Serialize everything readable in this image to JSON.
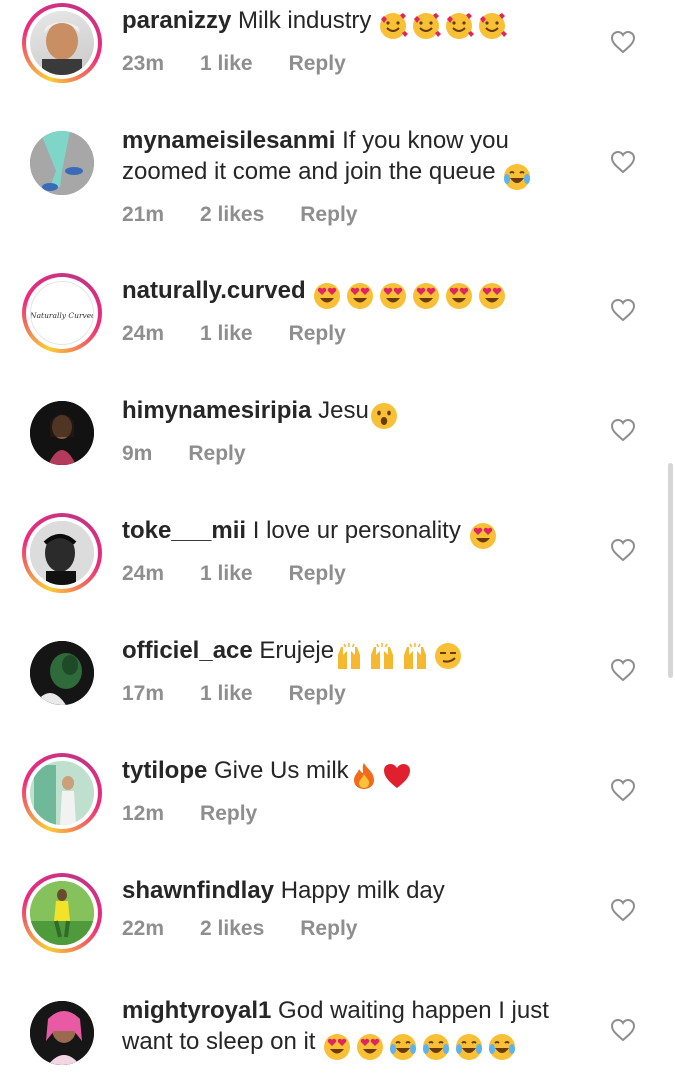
{
  "comments": [
    {
      "username": "paranizzy",
      "text": " Milk industry",
      "text2": "",
      "emoji": "smiling-hearts x4",
      "time": "23m",
      "likes": "1 like",
      "reply": "Reply"
    },
    {
      "username": "mynameisilesanmi",
      "text": " If you know you",
      "text2": "zoomed it come and join the queue",
      "emoji": "tears-of-joy",
      "time": "21m",
      "likes": "2 likes",
      "reply": "Reply"
    },
    {
      "username": "naturally.curved",
      "text": "",
      "text2": "",
      "emoji": "heart-eyes x6",
      "time": "24m",
      "likes": "1 like",
      "reply": "Reply",
      "avatar_text": "Naturally Curved"
    },
    {
      "username": "himynamesiripia",
      "text": " Jesu",
      "text2": "",
      "emoji": "surprised",
      "time": "9m",
      "likes": "",
      "reply": "Reply"
    },
    {
      "username": "toke___mii",
      "text": " I love ur personality",
      "text2": "",
      "emoji": "heart-eyes",
      "time": "24m",
      "likes": "1 like",
      "reply": "Reply"
    },
    {
      "username": "officiel_ace",
      "text": " Erujeje",
      "text2": "",
      "emoji": "raised-hands x3, smirk",
      "time": "17m",
      "likes": "1 like",
      "reply": "Reply"
    },
    {
      "username": "tytilope",
      "text": " Give Us milk",
      "text2": "",
      "emoji": "fire, red-heart",
      "time": "12m",
      "likes": "",
      "reply": "Reply"
    },
    {
      "username": "shawnfindlay",
      "text": " Happy milk day",
      "text2": "",
      "emoji": "",
      "time": "22m",
      "likes": "2 likes",
      "reply": "Reply"
    },
    {
      "username": "mightyroyal1",
      "text": " God waiting happen I just",
      "text2": "want to sleep on it",
      "emoji": "heart-eyes x2, tears-of-joy x4",
      "time": "",
      "likes": "",
      "reply": ""
    }
  ],
  "colors": {
    "text": "#262626",
    "meta": "#8e8e8e",
    "ring_start": "#f9ce34",
    "ring_mid": "#ee2a7b",
    "ring_end": "#c13584"
  }
}
